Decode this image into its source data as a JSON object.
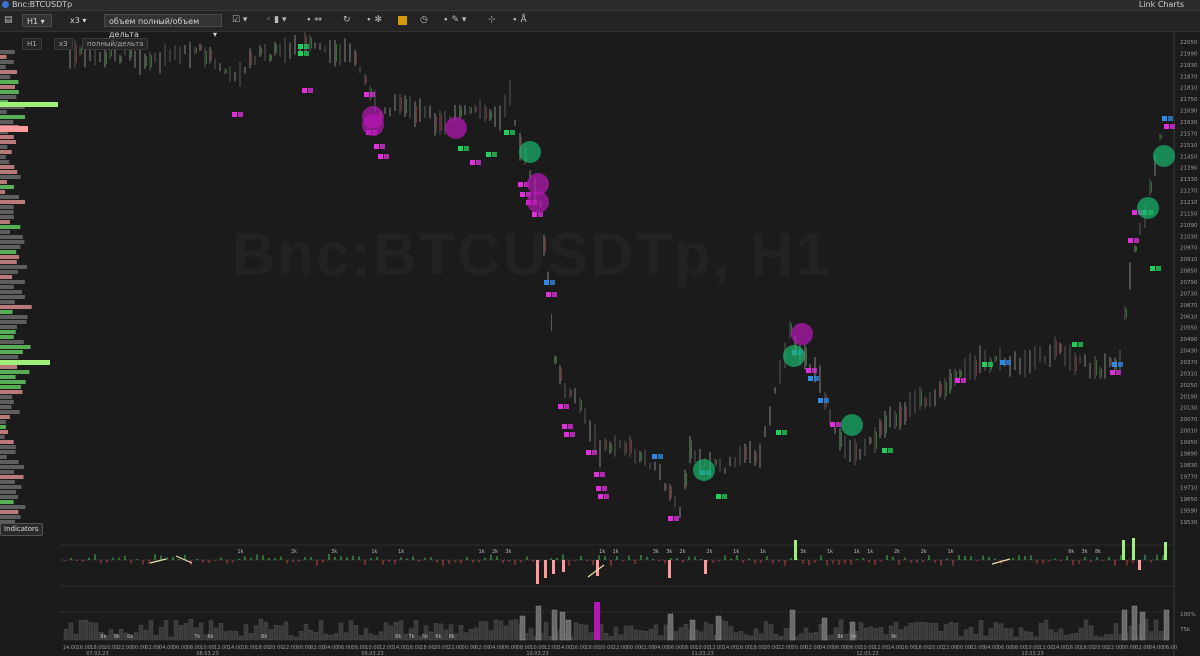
{
  "window": {
    "symbol": "Bnc:BTCUSDTp",
    "app_name": "Link Charts"
  },
  "toolbar": {
    "timeframe": "H1",
    "multiplier": "x3",
    "mode_select": "объем полный/объем дельта",
    "dropdown_glyph": "▾",
    "icons": [
      "checkbox-icon",
      "candle-type-icon",
      "dots-icon",
      "arrows-icon",
      "refresh-icon",
      "bug-icon",
      "color-swatch-icon",
      "clock-icon",
      "pencil-icon",
      "cursor-icon",
      "text-tool-icon"
    ],
    "accent_color": "#d39a0a"
  },
  "chart_tags": {
    "timeframe": "H1",
    "multiplier": "x3",
    "mode": "полный/дельта"
  },
  "indicators_label": "Indicators",
  "watermark": "Bnc:BTCUSDTp, H1",
  "price_axis": [
    "22050",
    "21990",
    "21930",
    "21870",
    "21810",
    "21750",
    "21690",
    "21630",
    "21570",
    "21510",
    "21450",
    "21390",
    "21330",
    "21270",
    "21210",
    "21150",
    "21090",
    "21030",
    "20970",
    "20910",
    "20850",
    "20790",
    "20730",
    "20670",
    "20610",
    "20550",
    "20490",
    "20430",
    "20370",
    "20310",
    "20250",
    "20190",
    "20130",
    "20070",
    "20010",
    "19950",
    "19890",
    "19830",
    "19770",
    "19710",
    "19650",
    "19590",
    "19530"
  ],
  "pct_axis": [
    "100%",
    "75k"
  ],
  "time_axis": [
    "14:00",
    "16:00",
    "18:00",
    "20:00",
    "22:00",
    "00:00",
    "02:00",
    "04:00",
    "06:00",
    "08:00",
    "10:00",
    "12:00",
    "14:00",
    "16:00",
    "18:00",
    "20:00",
    "22:00",
    "00:00",
    "02:00",
    "04:00",
    "06:00",
    "08:00",
    "10:00",
    "12:00",
    "14:00",
    "16:00",
    "18:00",
    "20:00",
    "22:00",
    "00:00",
    "02:00",
    "04:00",
    "06:00",
    "08:00",
    "10:00",
    "12:00",
    "14:00",
    "16:00",
    "18:00",
    "20:00",
    "22:00",
    "00:00",
    "02:00",
    "04:00",
    "06:00",
    "08:00",
    "10:00",
    "12:00",
    "14:00",
    "16:00",
    "18:00",
    "20:00",
    "22:00",
    "00:00",
    "02:00",
    "04:00",
    "06:00",
    "08:00",
    "10:00",
    "12:00",
    "14:00",
    "16:00",
    "18:00",
    "20:00",
    "22:00",
    "00:00",
    "02:00",
    "04:00",
    "06:00",
    "08:00",
    "10:00",
    "12:00",
    "14:00",
    "16:00",
    "18:00",
    "20:00",
    "22:00",
    "00:00",
    "02:00",
    "04:00",
    "06:00"
  ],
  "date_labels": [
    {
      "text": "07.03.23",
      "index": 2
    },
    {
      "text": "08.03.23",
      "index": 10
    },
    {
      "text": "09.03.23",
      "index": 22
    },
    {
      "text": "10.03.23",
      "index": 34
    },
    {
      "text": "11.03.23",
      "index": 46
    },
    {
      "text": "12.03.23",
      "index": 58
    },
    {
      "text": "13.03.23",
      "index": 70
    }
  ],
  "delta_labels": [
    {
      "text": "1k",
      "i": 6
    },
    {
      "text": "2k",
      "i": 10
    },
    {
      "text": "3k",
      "i": 13
    },
    {
      "text": "1k",
      "i": 16
    },
    {
      "text": "1k",
      "i": 18
    },
    {
      "text": "1k",
      "i": 24
    },
    {
      "text": "2k",
      "i": 25
    },
    {
      "text": "3k",
      "i": 26
    },
    {
      "text": "1k",
      "i": 33
    },
    {
      "text": "1k",
      "i": 34
    },
    {
      "text": "3k",
      "i": 37
    },
    {
      "text": "3k",
      "i": 38
    },
    {
      "text": "2k",
      "i": 39
    },
    {
      "text": "2k",
      "i": 41
    },
    {
      "text": "1k",
      "i": 43
    },
    {
      "text": "1k",
      "i": 45
    },
    {
      "text": "3k",
      "i": 48
    },
    {
      "text": "1k",
      "i": 50
    },
    {
      "text": "1k",
      "i": 52
    },
    {
      "text": "1k",
      "i": 53
    },
    {
      "text": "2k",
      "i": 55
    },
    {
      "text": "2k",
      "i": 57
    },
    {
      "text": "1k",
      "i": 59
    },
    {
      "text": "9k",
      "i": 68
    },
    {
      "text": "3k",
      "i": 69
    },
    {
      "text": "8k",
      "i": 70
    }
  ],
  "volume_labels": [
    {
      "text": "8k",
      "i": 1
    },
    {
      "text": "9k",
      "i": 2
    },
    {
      "text": "6k",
      "i": 3
    },
    {
      "text": "7k",
      "i": 8
    },
    {
      "text": "6k",
      "i": 9
    },
    {
      "text": "8k",
      "i": 13
    },
    {
      "text": "8k",
      "i": 23
    },
    {
      "text": "7k",
      "i": 24
    },
    {
      "text": "5k",
      "i": 25
    },
    {
      "text": "6k",
      "i": 26
    },
    {
      "text": "8k",
      "i": 27
    },
    {
      "text": "8k",
      "i": 56
    },
    {
      "text": "9k",
      "i": 57
    },
    {
      "text": "9k",
      "i": 60
    }
  ],
  "colors": {
    "bg": "#1b1b1b",
    "up": "#1fd15a",
    "down": "#e52de0",
    "blue": "#2d8be8",
    "profile_bull": "#62c862",
    "profile_bear": "#d58a8a",
    "profile_neutral": "#6a6a6a",
    "green_circle": "#1bb36b",
    "magenta_circle": "#b418b4"
  }
}
